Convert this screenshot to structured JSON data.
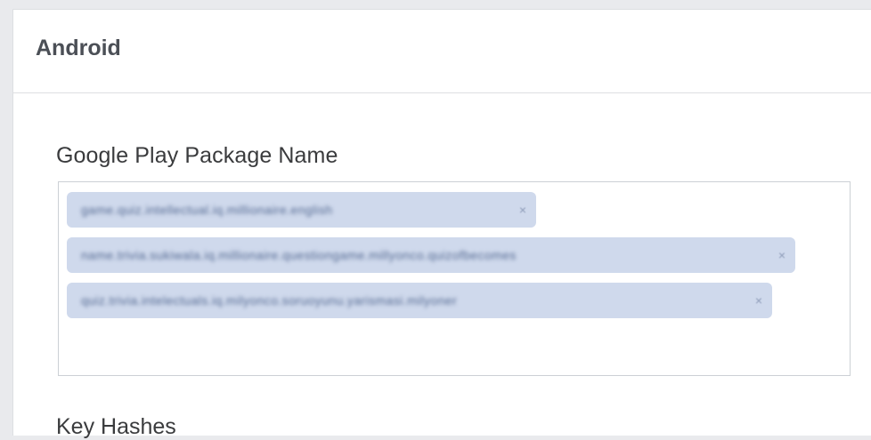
{
  "section": {
    "title": "Android"
  },
  "package_field": {
    "label": "Google Play Package Name",
    "tokens": [
      {
        "text": "game.quiz.intellectual.iq.millionaire.english",
        "remove": "×"
      },
      {
        "text": "name.trivia.sukiwala.iq.millionaire.questiongame.millyonco.quizofbecomes",
        "remove": "×"
      },
      {
        "text": "quiz.trivia.intelectuals.iq.milyonco.soruoyunu.yarismasi.milyoner",
        "remove": "×"
      }
    ]
  },
  "next_field": {
    "label": "Key Hashes"
  }
}
